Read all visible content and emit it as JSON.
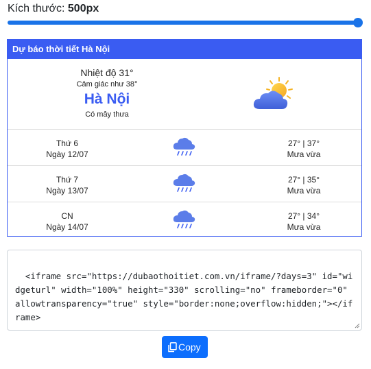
{
  "size_control": {
    "label": "Kích thước:",
    "value": "500px",
    "slider_level": 1.0
  },
  "widget": {
    "header": "Dự báo thời tiết Hà Nội",
    "current": {
      "temp": "Nhiệt độ 31°",
      "feels_like": "Cảm giác như 38°",
      "city": "Hà Nội",
      "condition": "Có mây thưa",
      "icon": "partly-cloudy-sun-icon"
    },
    "days": [
      {
        "day": "Thứ 6",
        "date": "Ngày 12/07",
        "temps": "27° | 37°",
        "condition": "Mưa vừa",
        "icon": "rain-cloud-icon"
      },
      {
        "day": "Thứ 7",
        "date": "Ngày 13/07",
        "temps": "27° | 35°",
        "condition": "Mưa vừa",
        "icon": "rain-cloud-icon"
      },
      {
        "day": "CN",
        "date": "Ngày 14/07",
        "temps": "27° | 34°",
        "condition": "Mưa vừa",
        "icon": "rain-cloud-icon"
      }
    ]
  },
  "embed_code": "<iframe src=\"https://dubaothoitiet.com.vn/iframe/?days=3\" id=\"widgeturl\" width=\"100%\" height=\"330\" scrolling=\"no\" frameborder=\"0\" allowtransparency=\"true\" style=\"border:none;overflow:hidden;\"></iframe>",
  "copy_button": {
    "label": "Copy",
    "icon": "copy-icon"
  },
  "colors": {
    "accent": "#3a5cf2",
    "slider": "#1a73e8",
    "button": "#0d6efd"
  }
}
